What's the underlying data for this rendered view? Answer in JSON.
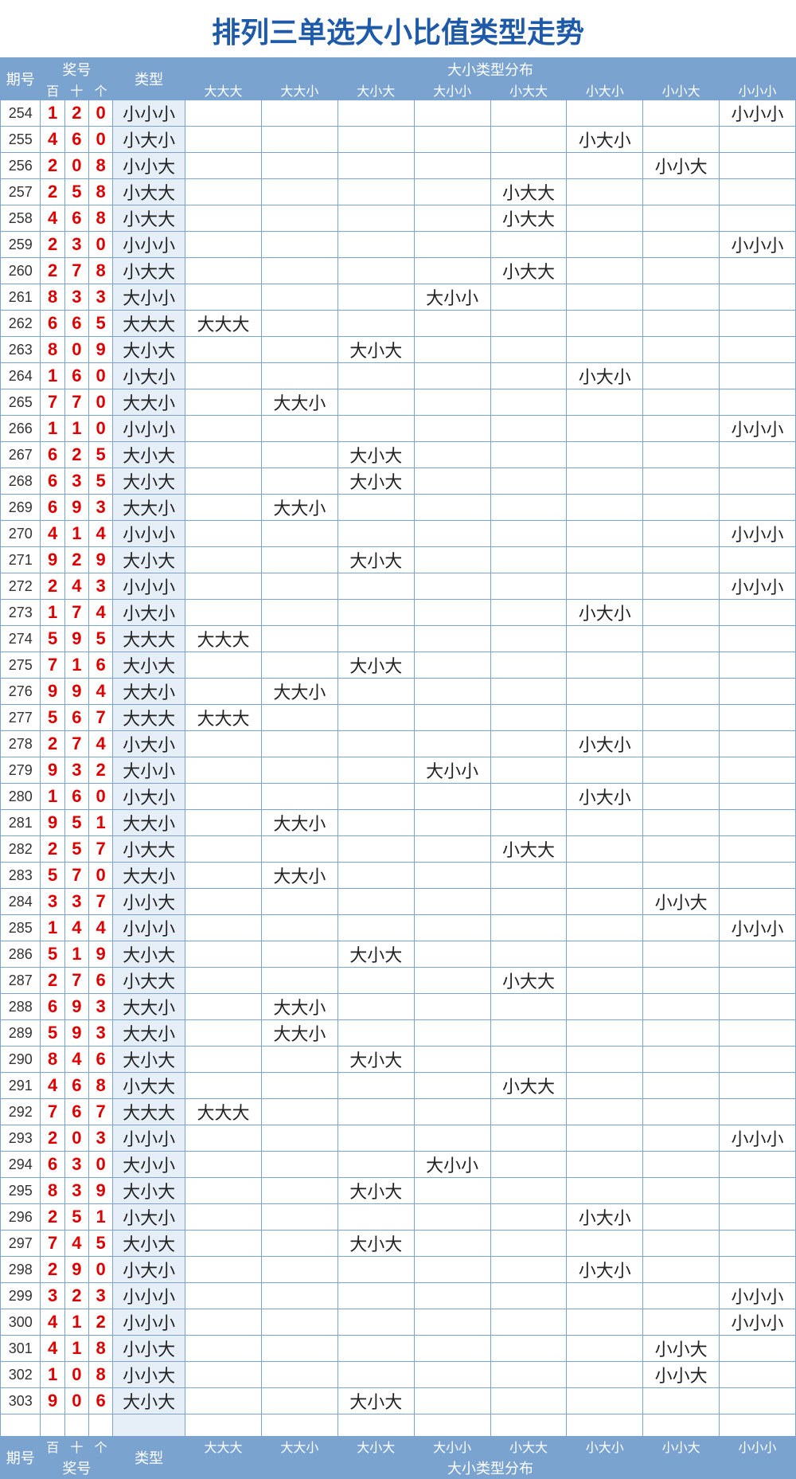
{
  "title": "排列三单选大小比值类型走势",
  "headers": {
    "issue": "期号",
    "numbers": "奖号",
    "bai": "百",
    "shi": "十",
    "ge": "个",
    "type": "类型",
    "dist": "大小类型分布",
    "cols": [
      "大大大",
      "大大小",
      "大小大",
      "大小小",
      "小大大",
      "小大小",
      "小小大",
      "小小小"
    ]
  },
  "rows": [
    {
      "issue": "254",
      "d": [
        "1",
        "2",
        "0"
      ],
      "type": "小小小",
      "dist": [
        null,
        null,
        null,
        null,
        null,
        null,
        null,
        "小小小"
      ]
    },
    {
      "issue": "255",
      "d": [
        "4",
        "6",
        "0"
      ],
      "type": "小大小",
      "dist": [
        null,
        null,
        null,
        null,
        null,
        "小大小",
        null,
        null
      ]
    },
    {
      "issue": "256",
      "d": [
        "2",
        "0",
        "8"
      ],
      "type": "小小大",
      "dist": [
        null,
        null,
        null,
        null,
        null,
        null,
        "小小大",
        null
      ]
    },
    {
      "issue": "257",
      "d": [
        "2",
        "5",
        "8"
      ],
      "type": "小大大",
      "dist": [
        null,
        null,
        null,
        null,
        "小大大",
        null,
        null,
        null
      ]
    },
    {
      "issue": "258",
      "d": [
        "4",
        "6",
        "8"
      ],
      "type": "小大大",
      "dist": [
        null,
        null,
        null,
        null,
        "小大大",
        null,
        null,
        null
      ]
    },
    {
      "issue": "259",
      "d": [
        "2",
        "3",
        "0"
      ],
      "type": "小小小",
      "dist": [
        null,
        null,
        null,
        null,
        null,
        null,
        null,
        "小小小"
      ]
    },
    {
      "issue": "260",
      "d": [
        "2",
        "7",
        "8"
      ],
      "type": "小大大",
      "dist": [
        null,
        null,
        null,
        null,
        "小大大",
        null,
        null,
        null
      ]
    },
    {
      "issue": "261",
      "d": [
        "8",
        "3",
        "3"
      ],
      "type": "大小小",
      "dist": [
        null,
        null,
        null,
        "大小小",
        null,
        null,
        null,
        null
      ]
    },
    {
      "issue": "262",
      "d": [
        "6",
        "6",
        "5"
      ],
      "type": "大大大",
      "dist": [
        "大大大",
        null,
        null,
        null,
        null,
        null,
        null,
        null
      ]
    },
    {
      "issue": "263",
      "d": [
        "8",
        "0",
        "9"
      ],
      "type": "大小大",
      "dist": [
        null,
        null,
        "大小大",
        null,
        null,
        null,
        null,
        null
      ]
    },
    {
      "issue": "264",
      "d": [
        "1",
        "6",
        "0"
      ],
      "type": "小大小",
      "dist": [
        null,
        null,
        null,
        null,
        null,
        "小大小",
        null,
        null
      ]
    },
    {
      "issue": "265",
      "d": [
        "7",
        "7",
        "0"
      ],
      "type": "大大小",
      "dist": [
        null,
        "大大小",
        null,
        null,
        null,
        null,
        null,
        null
      ]
    },
    {
      "issue": "266",
      "d": [
        "1",
        "1",
        "0"
      ],
      "type": "小小小",
      "dist": [
        null,
        null,
        null,
        null,
        null,
        null,
        null,
        "小小小"
      ]
    },
    {
      "issue": "267",
      "d": [
        "6",
        "2",
        "5"
      ],
      "type": "大小大",
      "dist": [
        null,
        null,
        "大小大",
        null,
        null,
        null,
        null,
        null
      ]
    },
    {
      "issue": "268",
      "d": [
        "6",
        "3",
        "5"
      ],
      "type": "大小大",
      "dist": [
        null,
        null,
        "大小大",
        null,
        null,
        null,
        null,
        null
      ]
    },
    {
      "issue": "269",
      "d": [
        "6",
        "9",
        "3"
      ],
      "type": "大大小",
      "dist": [
        null,
        "大大小",
        null,
        null,
        null,
        null,
        null,
        null
      ]
    },
    {
      "issue": "270",
      "d": [
        "4",
        "1",
        "4"
      ],
      "type": "小小小",
      "dist": [
        null,
        null,
        null,
        null,
        null,
        null,
        null,
        "小小小"
      ]
    },
    {
      "issue": "271",
      "d": [
        "9",
        "2",
        "9"
      ],
      "type": "大小大",
      "dist": [
        null,
        null,
        "大小大",
        null,
        null,
        null,
        null,
        null
      ]
    },
    {
      "issue": "272",
      "d": [
        "2",
        "4",
        "3"
      ],
      "type": "小小小",
      "dist": [
        null,
        null,
        null,
        null,
        null,
        null,
        null,
        "小小小"
      ]
    },
    {
      "issue": "273",
      "d": [
        "1",
        "7",
        "4"
      ],
      "type": "小大小",
      "dist": [
        null,
        null,
        null,
        null,
        null,
        "小大小",
        null,
        null
      ]
    },
    {
      "issue": "274",
      "d": [
        "5",
        "9",
        "5"
      ],
      "type": "大大大",
      "dist": [
        "大大大",
        null,
        null,
        null,
        null,
        null,
        null,
        null
      ]
    },
    {
      "issue": "275",
      "d": [
        "7",
        "1",
        "6"
      ],
      "type": "大小大",
      "dist": [
        null,
        null,
        "大小大",
        null,
        null,
        null,
        null,
        null
      ]
    },
    {
      "issue": "276",
      "d": [
        "9",
        "9",
        "4"
      ],
      "type": "大大小",
      "dist": [
        null,
        "大大小",
        null,
        null,
        null,
        null,
        null,
        null
      ]
    },
    {
      "issue": "277",
      "d": [
        "5",
        "6",
        "7"
      ],
      "type": "大大大",
      "dist": [
        "大大大",
        null,
        null,
        null,
        null,
        null,
        null,
        null
      ]
    },
    {
      "issue": "278",
      "d": [
        "2",
        "7",
        "4"
      ],
      "type": "小大小",
      "dist": [
        null,
        null,
        null,
        null,
        null,
        "小大小",
        null,
        null
      ]
    },
    {
      "issue": "279",
      "d": [
        "9",
        "3",
        "2"
      ],
      "type": "大小小",
      "dist": [
        null,
        null,
        null,
        "大小小",
        null,
        null,
        null,
        null
      ]
    },
    {
      "issue": "280",
      "d": [
        "1",
        "6",
        "0"
      ],
      "type": "小大小",
      "dist": [
        null,
        null,
        null,
        null,
        null,
        "小大小",
        null,
        null
      ]
    },
    {
      "issue": "281",
      "d": [
        "9",
        "5",
        "1"
      ],
      "type": "大大小",
      "dist": [
        null,
        "大大小",
        null,
        null,
        null,
        null,
        null,
        null
      ]
    },
    {
      "issue": "282",
      "d": [
        "2",
        "5",
        "7"
      ],
      "type": "小大大",
      "dist": [
        null,
        null,
        null,
        null,
        "小大大",
        null,
        null,
        null
      ]
    },
    {
      "issue": "283",
      "d": [
        "5",
        "7",
        "0"
      ],
      "type": "大大小",
      "dist": [
        null,
        "大大小",
        null,
        null,
        null,
        null,
        null,
        null
      ]
    },
    {
      "issue": "284",
      "d": [
        "3",
        "3",
        "7"
      ],
      "type": "小小大",
      "dist": [
        null,
        null,
        null,
        null,
        null,
        null,
        "小小大",
        null
      ]
    },
    {
      "issue": "285",
      "d": [
        "1",
        "4",
        "4"
      ],
      "type": "小小小",
      "dist": [
        null,
        null,
        null,
        null,
        null,
        null,
        null,
        "小小小"
      ]
    },
    {
      "issue": "286",
      "d": [
        "5",
        "1",
        "9"
      ],
      "type": "大小大",
      "dist": [
        null,
        null,
        "大小大",
        null,
        null,
        null,
        null,
        null
      ]
    },
    {
      "issue": "287",
      "d": [
        "2",
        "7",
        "6"
      ],
      "type": "小大大",
      "dist": [
        null,
        null,
        null,
        null,
        "小大大",
        null,
        null,
        null
      ]
    },
    {
      "issue": "288",
      "d": [
        "6",
        "9",
        "3"
      ],
      "type": "大大小",
      "dist": [
        null,
        "大大小",
        null,
        null,
        null,
        null,
        null,
        null
      ]
    },
    {
      "issue": "289",
      "d": [
        "5",
        "9",
        "3"
      ],
      "type": "大大小",
      "dist": [
        null,
        "大大小",
        null,
        null,
        null,
        null,
        null,
        null
      ]
    },
    {
      "issue": "290",
      "d": [
        "8",
        "4",
        "6"
      ],
      "type": "大小大",
      "dist": [
        null,
        null,
        "大小大",
        null,
        null,
        null,
        null,
        null
      ]
    },
    {
      "issue": "291",
      "d": [
        "4",
        "6",
        "8"
      ],
      "type": "小大大",
      "dist": [
        null,
        null,
        null,
        null,
        "小大大",
        null,
        null,
        null
      ]
    },
    {
      "issue": "292",
      "d": [
        "7",
        "6",
        "7"
      ],
      "type": "大大大",
      "dist": [
        "大大大",
        null,
        null,
        null,
        null,
        null,
        null,
        null
      ]
    },
    {
      "issue": "293",
      "d": [
        "2",
        "0",
        "3"
      ],
      "type": "小小小",
      "dist": [
        null,
        null,
        null,
        null,
        null,
        null,
        null,
        "小小小"
      ]
    },
    {
      "issue": "294",
      "d": [
        "6",
        "3",
        "0"
      ],
      "type": "大小小",
      "dist": [
        null,
        null,
        null,
        "大小小",
        null,
        null,
        null,
        null
      ]
    },
    {
      "issue": "295",
      "d": [
        "8",
        "3",
        "9"
      ],
      "type": "大小大",
      "dist": [
        null,
        null,
        "大小大",
        null,
        null,
        null,
        null,
        null
      ]
    },
    {
      "issue": "296",
      "d": [
        "2",
        "5",
        "1"
      ],
      "type": "小大小",
      "dist": [
        null,
        null,
        null,
        null,
        null,
        "小大小",
        null,
        null
      ]
    },
    {
      "issue": "297",
      "d": [
        "7",
        "4",
        "5"
      ],
      "type": "大小大",
      "dist": [
        null,
        null,
        "大小大",
        null,
        null,
        null,
        null,
        null
      ]
    },
    {
      "issue": "298",
      "d": [
        "2",
        "9",
        "0"
      ],
      "type": "小大小",
      "dist": [
        null,
        null,
        null,
        null,
        null,
        "小大小",
        null,
        null
      ]
    },
    {
      "issue": "299",
      "d": [
        "3",
        "2",
        "3"
      ],
      "type": "小小小",
      "dist": [
        null,
        null,
        null,
        null,
        null,
        null,
        null,
        "小小小"
      ]
    },
    {
      "issue": "300",
      "d": [
        "4",
        "1",
        "2"
      ],
      "type": "小小小",
      "dist": [
        null,
        null,
        null,
        null,
        null,
        null,
        null,
        "小小小"
      ]
    },
    {
      "issue": "301",
      "d": [
        "4",
        "1",
        "8"
      ],
      "type": "小小大",
      "dist": [
        null,
        null,
        null,
        null,
        null,
        null,
        "小小大",
        null
      ]
    },
    {
      "issue": "302",
      "d": [
        "1",
        "0",
        "8"
      ],
      "type": "小小大",
      "dist": [
        null,
        null,
        null,
        null,
        null,
        null,
        "小小大",
        null
      ]
    },
    {
      "issue": "303",
      "d": [
        "9",
        "0",
        "6"
      ],
      "type": "大小大",
      "dist": [
        null,
        null,
        "大小大",
        null,
        null,
        null,
        null,
        null
      ]
    }
  ]
}
